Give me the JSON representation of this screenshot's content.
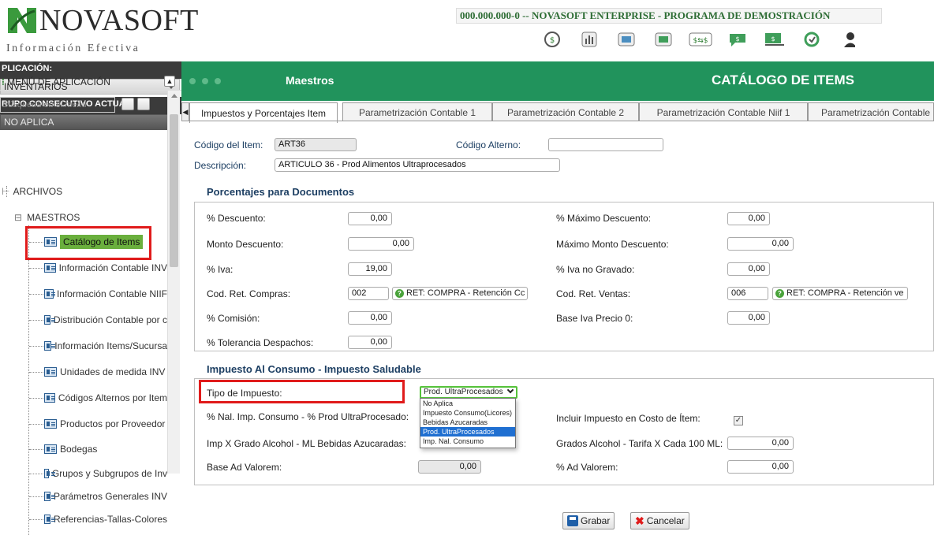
{
  "header": {
    "logo_text": "NOVASOFT",
    "logo_tagline": "Información Efectiva",
    "app_title": "000.000.000-0 -- NOVASOFT ENTERPRISE - PROGRAMA DE DEMOSTRACIÓN",
    "toolbar_icons": [
      "search-icon",
      "report-icon",
      "data-icon",
      "data-icon-2",
      "exchange-icon",
      "chat-icon",
      "finance-icon",
      "refresh-icon",
      "user-icon"
    ]
  },
  "sidebar": {
    "aplicacion_label": "PLICACIÓN:",
    "aplicacion_value": "INVENTARIOS",
    "consecutivo_label": "RUPO CONSECUTIVO ACTUAL:",
    "consecutivo_value": "NO APLICA",
    "menu_label": "MENÚ DE APLICACIÓN",
    "menu_search_placeholder": "Búsqueda en el menú",
    "tree": {
      "archivos": "ARCHIVOS",
      "maestros": "MAESTROS",
      "items": [
        "Catálogo de Items",
        "Información Contable INV",
        "Información Contable NIIF",
        "Distribución Contable por c",
        "Información Items/Sucursa",
        "Unidades de medida INV",
        "Códigos Alternos por Item",
        "Productos por Proveedor",
        "Bodegas",
        "Grupos y Subgrupos de Inv",
        "Parámetros Generales INV",
        "Referencias-Tallas-Colores"
      ]
    }
  },
  "panel": {
    "section": "Maestros",
    "title": "CATÁLOGO DE ITEMS",
    "tabs": [
      "Impuestos y Porcentajes Item",
      "Parametrización Contable 1",
      "Parametrización Contable 2",
      "Parametrización Contable Niif 1",
      "Parametrización Contable I"
    ]
  },
  "form": {
    "codigo_item_label": "Código del Item:",
    "codigo_item_value": "ART36",
    "codigo_alterno_label": "Código Alterno:",
    "codigo_alterno_value": "",
    "descripcion_label": "Descripción:",
    "descripcion_value": "ARTICULO 36 - Prod Alimentos Ultraprocesados",
    "porcentajes_heading": "Porcentajes para Documentos",
    "descuento_label": "% Descuento:",
    "descuento_value": "0,00",
    "max_descuento_label": "% Máximo Descuento:",
    "max_descuento_value": "0,00",
    "monto_descuento_label": "Monto Descuento:",
    "monto_descuento_value": "0,00",
    "max_monto_descuento_label": "Máximo Monto Descuento:",
    "max_monto_descuento_value": "0,00",
    "iva_label": "% Iva:",
    "iva_value": "19,00",
    "iva_no_gravado_label": "% Iva no Gravado:",
    "iva_no_gravado_value": "0,00",
    "ret_compras_label": "Cod. Ret. Compras:",
    "ret_compras_code": "002",
    "ret_compras_desc": "RET: COMPRA - Retención Cc",
    "ret_ventas_label": "Cod. Ret. Ventas:",
    "ret_ventas_code": "006",
    "ret_ventas_desc": "RET: COMPRA - Retención ve",
    "comision_label": "% Comisión:",
    "comision_value": "0,00",
    "base_iva_label": "Base Iva Precio 0:",
    "base_iva_value": "0,00",
    "tolerancia_label": "% Tolerancia Despachos:",
    "tolerancia_value": "0,00",
    "impuesto_heading": "Impuesto Al Consumo - Impuesto Saludable",
    "tipo_impuesto_label": "Tipo de Impuesto:",
    "tipo_impuesto_value": "Prod. UltraProcesados",
    "tipo_impuesto_options": [
      "No Aplica",
      "Impuesto Consumo(Licores)",
      "Bebidas Azucaradas",
      "Prod. UltraProcesados",
      "Imp. Nal. Consumo"
    ],
    "nal_imp_label": "% Nal. Imp. Consumo - % Prod UltraProcesado:",
    "incluir_costo_label": "Incluir Impuesto en Costo de Ítem:",
    "incluir_costo_checked": "✓",
    "imp_grado_label": "Imp X Grado Alcohol - ML Bebidas Azucaradas:",
    "grados_alcohol_label": "Grados Alcohol - Tarifa X Cada 100 ML:",
    "grados_alcohol_value": "0,00",
    "base_ad_valorem_label": "Base Ad Valorem:",
    "base_ad_valorem_value": "0,00",
    "ad_valorem_label": "% Ad Valorem:",
    "ad_valorem_value": "0,00"
  },
  "actions": {
    "save_label": "Grabar",
    "cancel_label": "Cancelar"
  },
  "colors": {
    "header_green": "#21935c",
    "highlight_red": "#e01b1b",
    "selected_green": "#6aaf3d",
    "heading_blue": "#1d3f63"
  }
}
